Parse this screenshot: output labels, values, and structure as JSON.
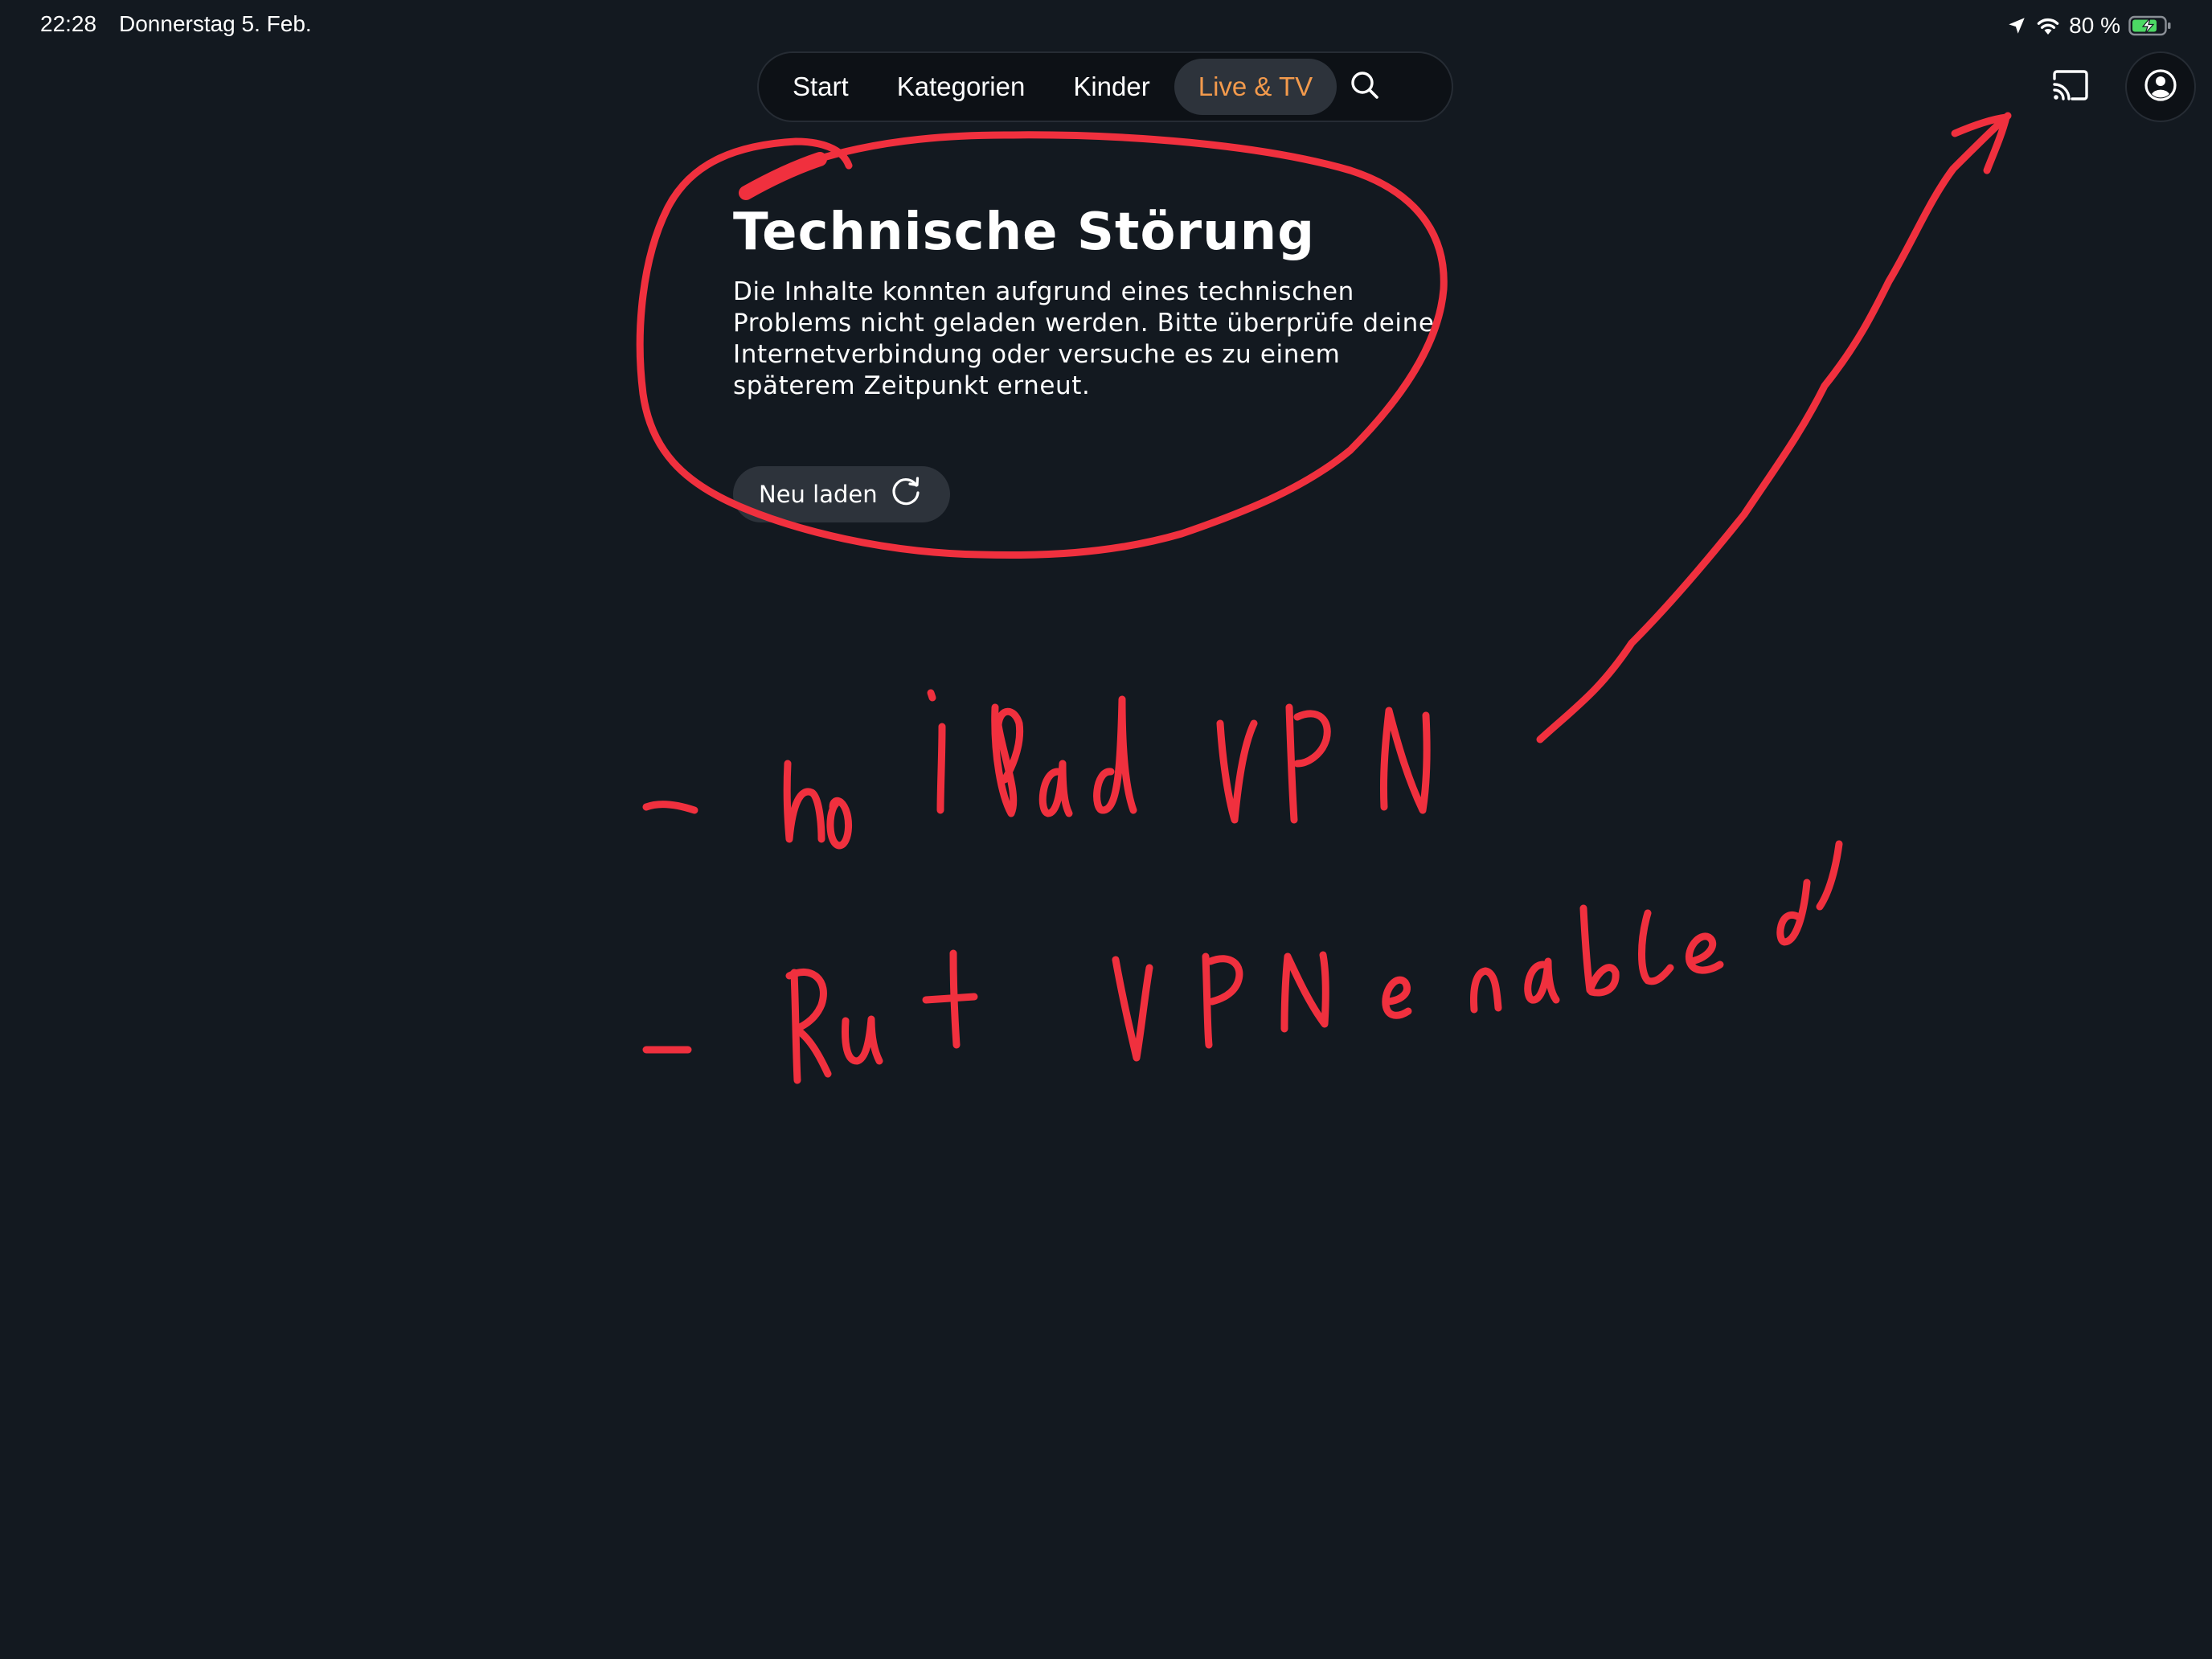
{
  "status_bar": {
    "time": "22:28",
    "date": "Donnerstag 5. Feb.",
    "battery_percent": "80 %",
    "icons": [
      "location-icon",
      "wifi-icon",
      "battery-charging-icon"
    ]
  },
  "nav": {
    "items": [
      {
        "label": "Start",
        "active": false
      },
      {
        "label": "Kategorien",
        "active": false
      },
      {
        "label": "Kinder",
        "active": false
      },
      {
        "label": "Live & TV",
        "active": true
      }
    ],
    "search_icon": "search-icon",
    "active_color": "#f39a4c"
  },
  "header_actions": {
    "cast_icon": "cast-icon",
    "profile_icon": "profile-icon"
  },
  "error": {
    "title": "Technische Störung",
    "message": "Die Inhalte konnten aufgrund eines technischen\nProblems nicht geladen werden. Bitte überprüfe deine\nInternetverbindung oder versuche es zu einem\nspäterem Zeitpunkt erneut.",
    "reload_label": "Neu laden",
    "reload_icon": "reload-icon"
  },
  "annotation": {
    "line1": "- no iPad VPN",
    "line2": "- But VPN enabled",
    "color": "#f0303e"
  },
  "colors": {
    "background": "#131920",
    "pill_background": "#0d1116",
    "button_background": "#2d333b"
  }
}
